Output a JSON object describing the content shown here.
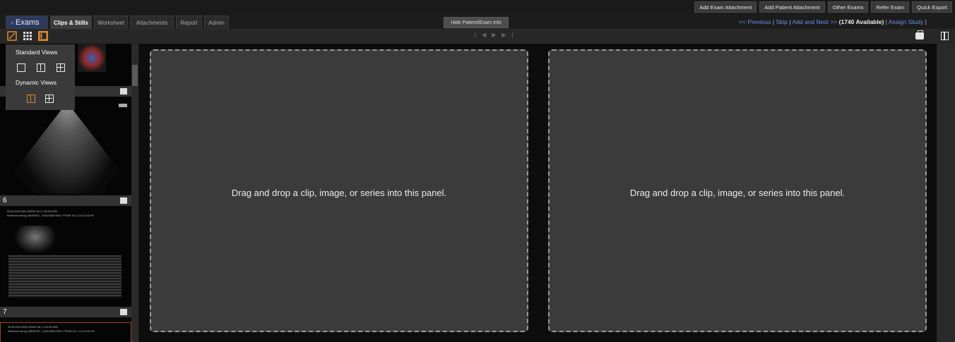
{
  "top_actions": [
    "Add Exam Attachment",
    "Add Patient Attachment",
    "Other Exams",
    "Refer Exam",
    "Quick Export"
  ],
  "tabs": {
    "exams": "Exams",
    "items": [
      "Clips & Stills",
      "Worksheet",
      "Attachments",
      "Report",
      "Admin"
    ],
    "active": "Clips & Stills"
  },
  "hide_info_label": "Hide Patient/Exam Info",
  "nav": {
    "previous": "<< Previous",
    "skip": "Skip",
    "add_next": "Add and Next >>",
    "available": "(1740 Available)",
    "assign": "Assign Study"
  },
  "views_menu": {
    "standard_title": "Standard Views",
    "dynamic_title": "Dynamic Views"
  },
  "thumbnails": [
    {
      "number": "6"
    },
    {
      "number": "7"
    }
  ],
  "thumb_text": {
    "line1": "05-05-2018 0000      CARDIO        Mi  1.4   05-05-2018",
    "line2": "Reference Wrong  UNDERSO.. 14/01/1958  PED4 / PF5VB    Tis  1.2   01:20:06 PM"
  },
  "panels": [
    {
      "message": "Drag and drop a clip, image, or series into this panel."
    },
    {
      "message": "Drag and drop a clip, image, or series into this panel."
    }
  ],
  "colors": {
    "accent_orange": "#e08a2e",
    "link_blue": "#6e8fe6",
    "panel_bg": "#3b3b3b"
  }
}
